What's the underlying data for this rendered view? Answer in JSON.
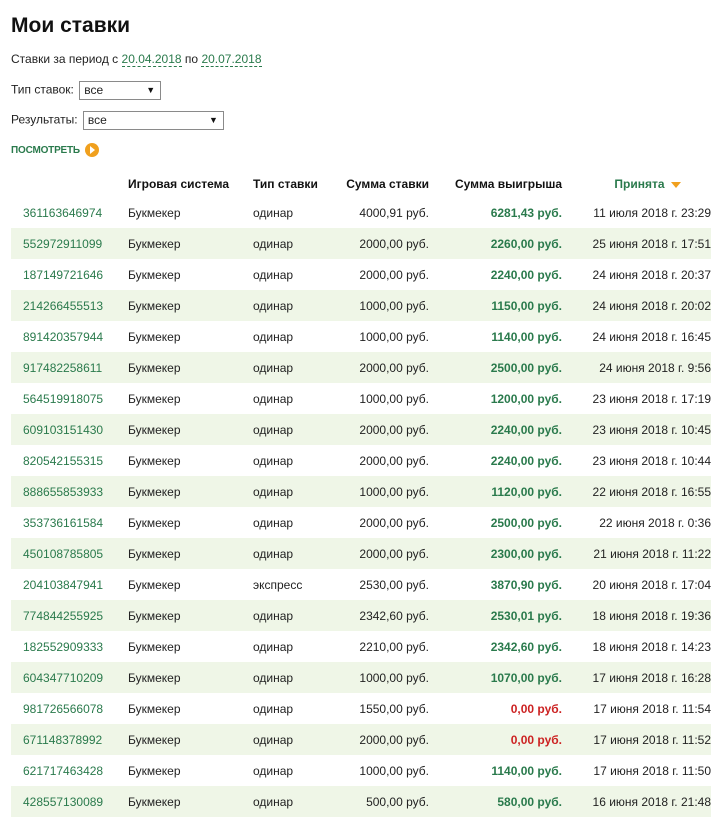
{
  "page": {
    "title": "Мои ставки"
  },
  "period": {
    "prefix": "Ставки за период с",
    "from": "20.04.2018",
    "middle": "по",
    "to": "20.07.2018"
  },
  "filters": {
    "type_label": "Тип ставок:",
    "type_value": "все",
    "results_label": "Результаты:",
    "results_value": "все"
  },
  "show_button": {
    "label": "ПОСМОТРЕТЬ",
    "icon": "arrow-right-circle-icon"
  },
  "colors": {
    "accent_green": "#2a7a4c",
    "row_stripe": "#eff6e7",
    "orange": "#f0a01e",
    "loss_red": "#cc2222"
  },
  "table": {
    "headers": {
      "system": "Игровая система",
      "type": "Тип ставки",
      "stake": "Сумма ставки",
      "win": "Сумма выигрыша",
      "date": "Принята"
    },
    "sort_icon": "sort-desc-icon",
    "rows": [
      {
        "id": "361163646974",
        "system": "Букмекер",
        "type": "одинар",
        "stake": "4000,91 руб.",
        "win": "6281,43 руб.",
        "date": "11 июля 2018 г. 23:29"
      },
      {
        "id": "552972911099",
        "system": "Букмекер",
        "type": "одинар",
        "stake": "2000,00 руб.",
        "win": "2260,00 руб.",
        "date": "25 июня 2018 г. 17:51"
      },
      {
        "id": "187149721646",
        "system": "Букмекер",
        "type": "одинар",
        "stake": "2000,00 руб.",
        "win": "2240,00 руб.",
        "date": "24 июня 2018 г. 20:37"
      },
      {
        "id": "214266455513",
        "system": "Букмекер",
        "type": "одинар",
        "stake": "1000,00 руб.",
        "win": "1150,00 руб.",
        "date": "24 июня 2018 г. 20:02"
      },
      {
        "id": "891420357944",
        "system": "Букмекер",
        "type": "одинар",
        "stake": "1000,00 руб.",
        "win": "1140,00 руб.",
        "date": "24 июня 2018 г. 16:45"
      },
      {
        "id": "917482258611",
        "system": "Букмекер",
        "type": "одинар",
        "stake": "2000,00 руб.",
        "win": "2500,00 руб.",
        "date": "24 июня 2018 г. 9:56"
      },
      {
        "id": "564519918075",
        "system": "Букмекер",
        "type": "одинар",
        "stake": "1000,00 руб.",
        "win": "1200,00 руб.",
        "date": "23 июня 2018 г. 17:19"
      },
      {
        "id": "609103151430",
        "system": "Букмекер",
        "type": "одинар",
        "stake": "2000,00 руб.",
        "win": "2240,00 руб.",
        "date": "23 июня 2018 г. 10:45"
      },
      {
        "id": "820542155315",
        "system": "Букмекер",
        "type": "одинар",
        "stake": "2000,00 руб.",
        "win": "2240,00 руб.",
        "date": "23 июня 2018 г. 10:44"
      },
      {
        "id": "888655853933",
        "system": "Букмекер",
        "type": "одинар",
        "stake": "1000,00 руб.",
        "win": "1120,00 руб.",
        "date": "22 июня 2018 г. 16:55"
      },
      {
        "id": "353736161584",
        "system": "Букмекер",
        "type": "одинар",
        "stake": "2000,00 руб.",
        "win": "2500,00 руб.",
        "date": "22 июня 2018 г. 0:36"
      },
      {
        "id": "450108785805",
        "system": "Букмекер",
        "type": "одинар",
        "stake": "2000,00 руб.",
        "win": "2300,00 руб.",
        "date": "21 июня 2018 г. 11:22"
      },
      {
        "id": "204103847941",
        "system": "Букмекер",
        "type": "экспресс",
        "stake": "2530,00 руб.",
        "win": "3870,90 руб.",
        "date": "20 июня 2018 г. 17:04"
      },
      {
        "id": "774844255925",
        "system": "Букмекер",
        "type": "одинар",
        "stake": "2342,60 руб.",
        "win": "2530,01 руб.",
        "date": "18 июня 2018 г. 19:36"
      },
      {
        "id": "182552909333",
        "system": "Букмекер",
        "type": "одинар",
        "stake": "2210,00 руб.",
        "win": "2342,60 руб.",
        "date": "18 июня 2018 г. 14:23"
      },
      {
        "id": "604347710209",
        "system": "Букмекер",
        "type": "одинар",
        "stake": "1000,00 руб.",
        "win": "1070,00 руб.",
        "date": "17 июня 2018 г. 16:28"
      },
      {
        "id": "981726566078",
        "system": "Букмекер",
        "type": "одинар",
        "stake": "1550,00 руб.",
        "win": "0,00 руб.",
        "date": "17 июня 2018 г. 11:54",
        "zero": true
      },
      {
        "id": "671148378992",
        "system": "Букмекер",
        "type": "одинар",
        "stake": "2000,00 руб.",
        "win": "0,00 руб.",
        "date": "17 июня 2018 г. 11:52",
        "zero": true
      },
      {
        "id": "621717463428",
        "system": "Букмекер",
        "type": "одинар",
        "stake": "1000,00 руб.",
        "win": "1140,00 руб.",
        "date": "17 июня 2018 г. 11:50"
      },
      {
        "id": "428557130089",
        "system": "Букмекер",
        "type": "одинар",
        "stake": "500,00 руб.",
        "win": "580,00 руб.",
        "date": "16 июня 2018 г. 21:48"
      }
    ]
  }
}
